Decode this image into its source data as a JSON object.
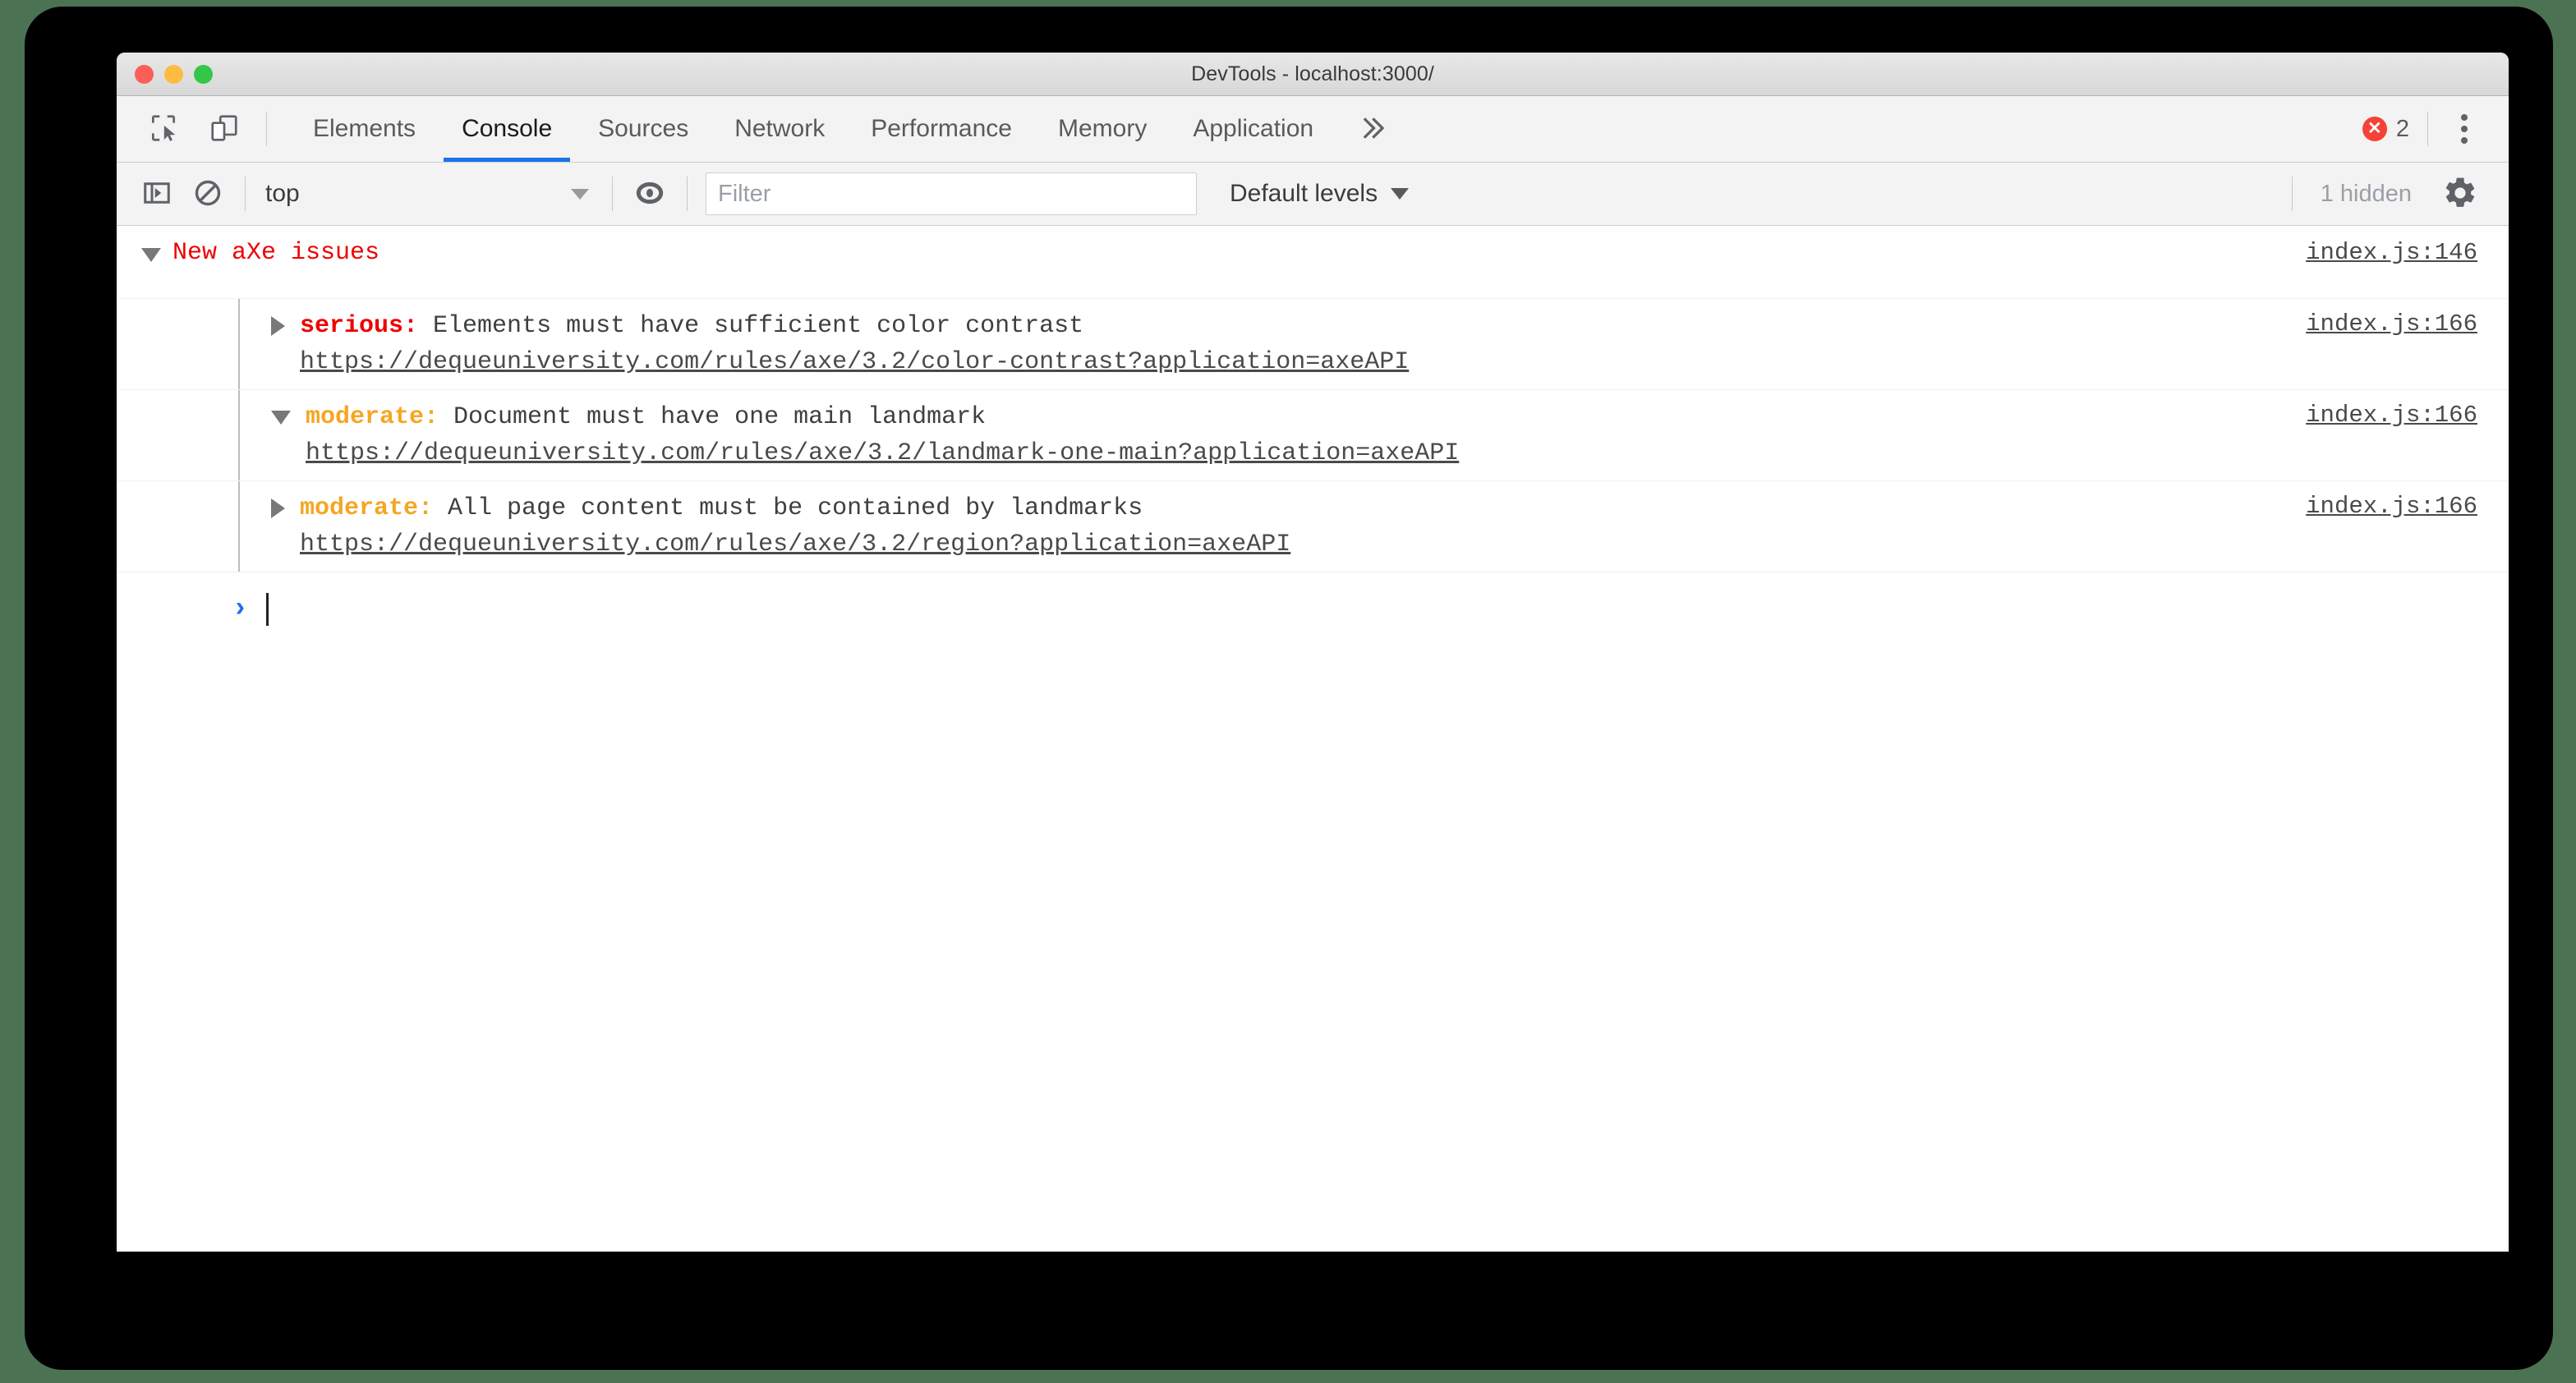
{
  "window": {
    "title": "DevTools - localhost:3000/",
    "traffic_lights": [
      "close",
      "minimize",
      "maximize"
    ]
  },
  "tabstrip": {
    "inspect_icon": "inspect-element-icon",
    "device_toolbar_icon": "device-toolbar-icon",
    "tabs": [
      {
        "label": "Elements",
        "active": false
      },
      {
        "label": "Console",
        "active": true
      },
      {
        "label": "Sources",
        "active": false
      },
      {
        "label": "Network",
        "active": false
      },
      {
        "label": "Performance",
        "active": false
      },
      {
        "label": "Memory",
        "active": false
      },
      {
        "label": "Application",
        "active": false
      }
    ],
    "more_tabs_icon": "chevron-double-right-icon",
    "error_badge_symbol": "✕",
    "error_count": "2",
    "error_badge_color": "#f44336",
    "kebab_icon": "more-vertical-icon"
  },
  "console_toolbar": {
    "sidebar_toggle_icon": "console-sidebar-icon",
    "clear_icon": "clear-console-icon",
    "context_selected": "top",
    "eye_icon": "live-expression-icon",
    "filter_value": "",
    "filter_placeholder": "Filter",
    "levels_label": "Default levels",
    "hidden_count": "1 hidden",
    "settings_icon": "gear-icon"
  },
  "console": {
    "group": {
      "title": "New aXe issues",
      "expanded": true,
      "color": "#ee0000",
      "source": "index.js:146"
    },
    "issues": [
      {
        "expanded": false,
        "impact": "serious:",
        "impact_color": "#ee0000",
        "message": "Elements must have sufficient color contrast",
        "url": "https://dequeuniversity.com/rules/axe/3.2/color-contrast?application=axeAPI",
        "source": "index.js:166"
      },
      {
        "expanded": true,
        "impact": "moderate:",
        "impact_color": "#f5a623",
        "message": "Document must have one main landmark",
        "url": "https://dequeuniversity.com/rules/axe/3.2/landmark-one-main?application=axeAPI",
        "source": "index.js:166"
      },
      {
        "expanded": false,
        "impact": "moderate:",
        "impact_color": "#f5a623",
        "message": "All page content must be contained by landmarks",
        "url": "https://dequeuniversity.com/rules/axe/3.2/region?application=axeAPI",
        "source": "index.js:166"
      }
    ],
    "prompt": {
      "chevron": "›",
      "value": ""
    }
  }
}
